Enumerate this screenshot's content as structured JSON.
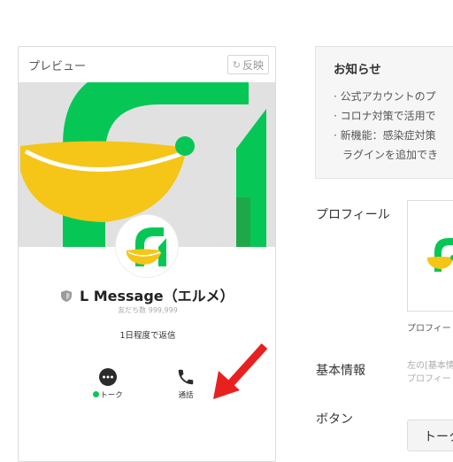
{
  "preview": {
    "title": "プレビュー",
    "flip_label": "反映",
    "account_name": "L Message（エルメ）",
    "friends_count": "友だち数 999,999",
    "reply_time": "1日程度で返信",
    "actions": [
      {
        "label": "トーク",
        "icon": "chat-bubble-icon"
      },
      {
        "label": "通話",
        "icon": "phone-icon"
      }
    ]
  },
  "notice": {
    "title": "お知らせ",
    "lines": [
      "· 公式アカウントのプ",
      "· コロナ対策で活用で",
      "· 新機能：感染症対策",
      "ラグインを追加でき"
    ]
  },
  "fields": {
    "profile_label": "プロフィール",
    "profile_image_caption": "プロフィー",
    "basic_info_label": "基本情報",
    "basic_info_hint_1": "左の[基本情",
    "basic_info_hint_2": "プロフィー",
    "button_label": "ボタン",
    "button_value": "トーク"
  },
  "colors": {
    "brand_green": "#06c755",
    "logo_yellow": "#f5c518",
    "arrow_red": "#e8201f",
    "cover_gray": "#e1e1e1"
  }
}
